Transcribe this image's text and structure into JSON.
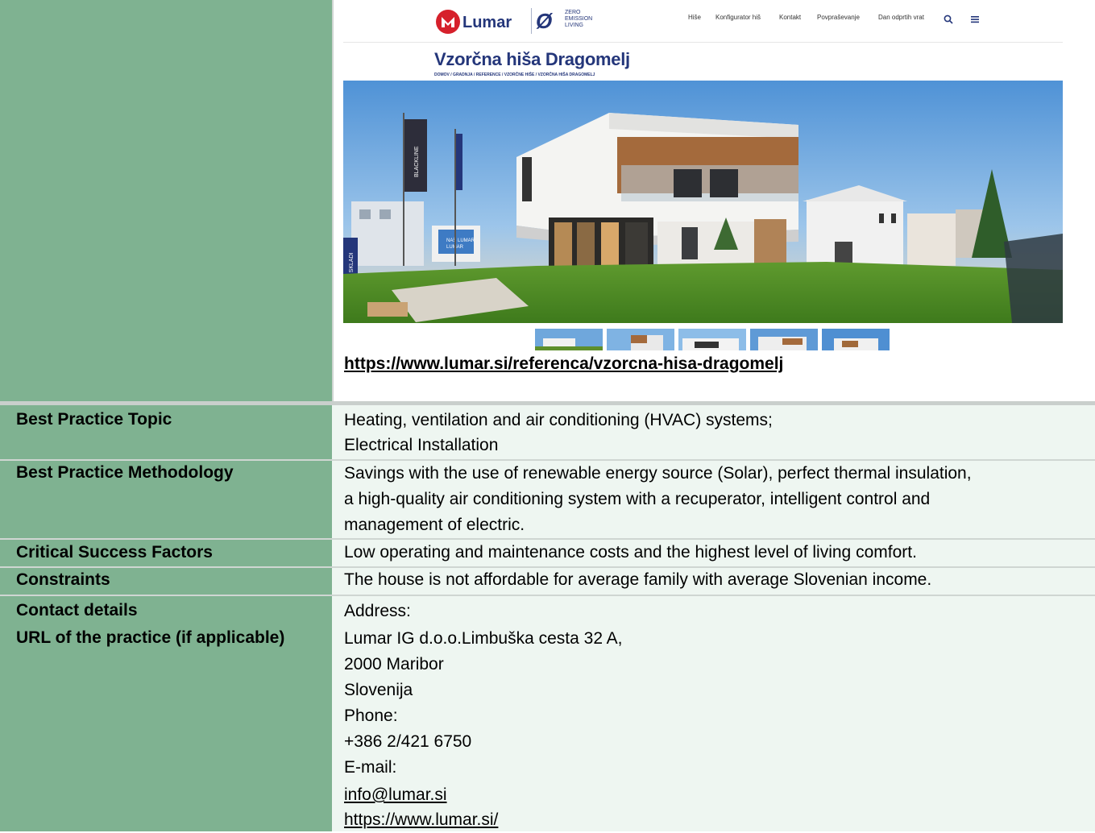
{
  "screenshot": {
    "brand": "Lumar",
    "zero_logo": [
      "ZERO",
      "EMISSION",
      "LIVING"
    ],
    "nav": [
      "Hiše",
      "Konfigurator hiš",
      "Kontakt",
      "Povpraševanje",
      "Dan odprtih vrat"
    ],
    "page_title": "Vzorčna hiša Dragomelj",
    "breadcrumb": "DOMOV / GRADNJA / REFERENCE / VZORČNE HIŠE / VZORČNA HIŠA DRAGOMELJ",
    "flag_text": "BLACKLINE",
    "sign_text": "EU SKLADI",
    "billboard": "NAŠ LUMAR",
    "billboard_brand": "LUMAR"
  },
  "reference_url": "https://www.lumar.si/referenca/vzorcna-hisa-dragomelj",
  "rows": {
    "topic": {
      "label": "Best Practice Topic",
      "lines": [
        "Heating, ventilation and air conditioning (HVAC) systems;",
        "Electrical Installation"
      ]
    },
    "methodology": {
      "label": "Best Practice Methodology",
      "lines": [
        "Savings with the use of renewable energy source (Solar), perfect thermal insulation,",
        "a high-quality air conditioning system with a recuperator, intelligent control and",
        "management of electric."
      ]
    },
    "factors": {
      "label": "Critical Success Factors",
      "text": "Low operating and maintenance costs and the highest level of living comfort."
    },
    "constraints": {
      "label": "Constraints",
      "text": "The house is not affordable for average family with average Slovenian income."
    },
    "contact": {
      "label1": "Contact details",
      "label2": "URL of the practice (if applicable)",
      "lines": [
        "Address:",
        "Lumar IG d.o.o.Limbuška cesta 32 A,",
        "2000 Maribor",
        "Slovenija",
        "Phone:",
        "+386 2/421 6750",
        "E-mail:"
      ],
      "email": "info@lumar.si",
      "url": "https://www.lumar.si/"
    }
  }
}
